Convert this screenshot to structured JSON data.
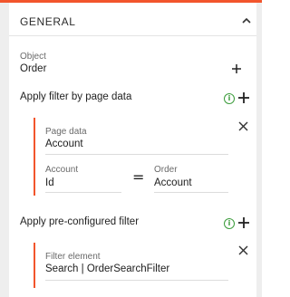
{
  "section": {
    "title": "GENERAL"
  },
  "object": {
    "label": "Object",
    "value": "Order"
  },
  "filter_by_page_data": {
    "label": "Apply filter by page data",
    "page_data_label": "Page data",
    "page_data_value": "Account",
    "left_label": "Account",
    "left_value": "Id",
    "operator": "=",
    "right_label": "Order",
    "right_value": "Account"
  },
  "preconfigured_filter": {
    "label": "Apply pre-configured filter",
    "filter_element_label": "Filter element",
    "filter_element_value": "Search | OrderSearchFilter"
  },
  "colors": {
    "accent": "#f2552c",
    "info": "#3a9b3a",
    "background_strip": "#eeeeee"
  },
  "icons": {
    "collapse": "chevron-up-icon",
    "add": "plus-icon",
    "remove": "close-icon",
    "info": "info-icon"
  }
}
